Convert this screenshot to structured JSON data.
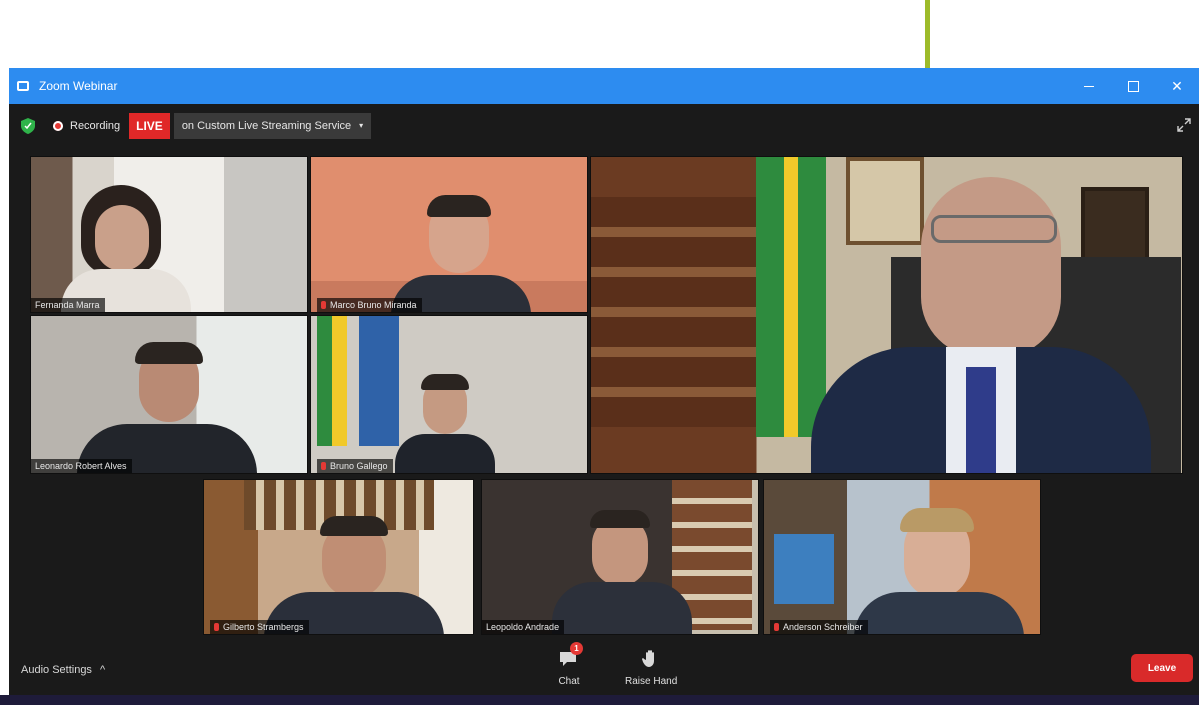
{
  "window": {
    "title": "Zoom Webinar",
    "close_glyph": "✕"
  },
  "status": {
    "recording_label": "Recording",
    "live_badge": "LIVE",
    "stream_selector": "on Custom Live Streaming Service",
    "caret": "▾"
  },
  "tiles": [
    {
      "name": "Fernanda Marra"
    },
    {
      "name": "Marco Bruno Miranda"
    },
    {
      "name": ""
    },
    {
      "name": "Leonardo Robert Alves"
    },
    {
      "name": "Bruno Gallego"
    },
    {
      "name": "Gilberto Strambergs"
    },
    {
      "name": "Leopoldo Andrade"
    },
    {
      "name": "Anderson Schreiber"
    }
  ],
  "bottom": {
    "audio_settings": "Audio Settings",
    "audio_caret": "^",
    "chat_label": "Chat",
    "chat_badge": "1",
    "raise_hand_label": "Raise Hand",
    "leave_label": "Leave"
  },
  "colors": {
    "titlebar": "#2d8cf0",
    "live": "#e02828",
    "leave": "#d92a2a",
    "callout": "#9dbb2a"
  },
  "icons": [
    "shield-icon",
    "recording-icon",
    "fullscreen-icon",
    "chat-icon",
    "raise-hand-icon",
    "microphone-off-icon",
    "app-icon"
  ]
}
